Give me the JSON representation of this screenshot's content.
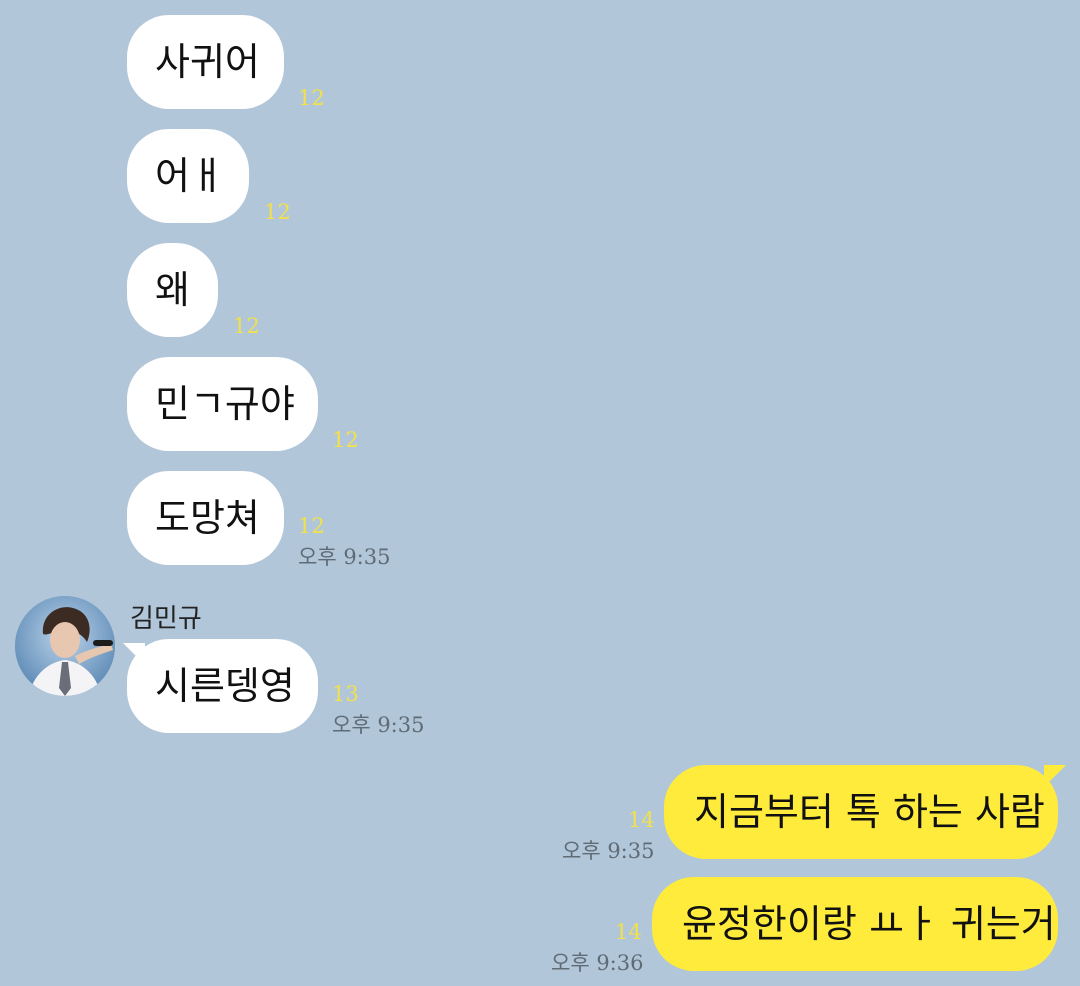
{
  "incoming": [
    {
      "text": "사귀어",
      "count": "12",
      "time": ""
    },
    {
      "text": "어ㅐ",
      "count": "12",
      "time": ""
    },
    {
      "text": "왜",
      "count": "12",
      "time": ""
    },
    {
      "text": "민ㄱ규야",
      "count": "12",
      "time": ""
    },
    {
      "text": "도망쳐",
      "count": "12",
      "time": "오후 9:35"
    }
  ],
  "sender": {
    "name": "김민규",
    "message": {
      "text": "시른뎅영",
      "count": "13",
      "time": "오후 9:35"
    }
  },
  "outgoing": [
    {
      "text": "지금부터 톡 하는 사람",
      "count": "14",
      "time": "오후 9:35"
    },
    {
      "text": "윤정한이랑 ㅛㅏ 귀는거",
      "count": "14",
      "time": "오후 9:36"
    }
  ],
  "colors": {
    "background": "#b1c6d9",
    "incoming_bubble": "#ffffff",
    "outgoing_bubble": "#ffeb3b",
    "unread_count": "#f2e14a"
  }
}
